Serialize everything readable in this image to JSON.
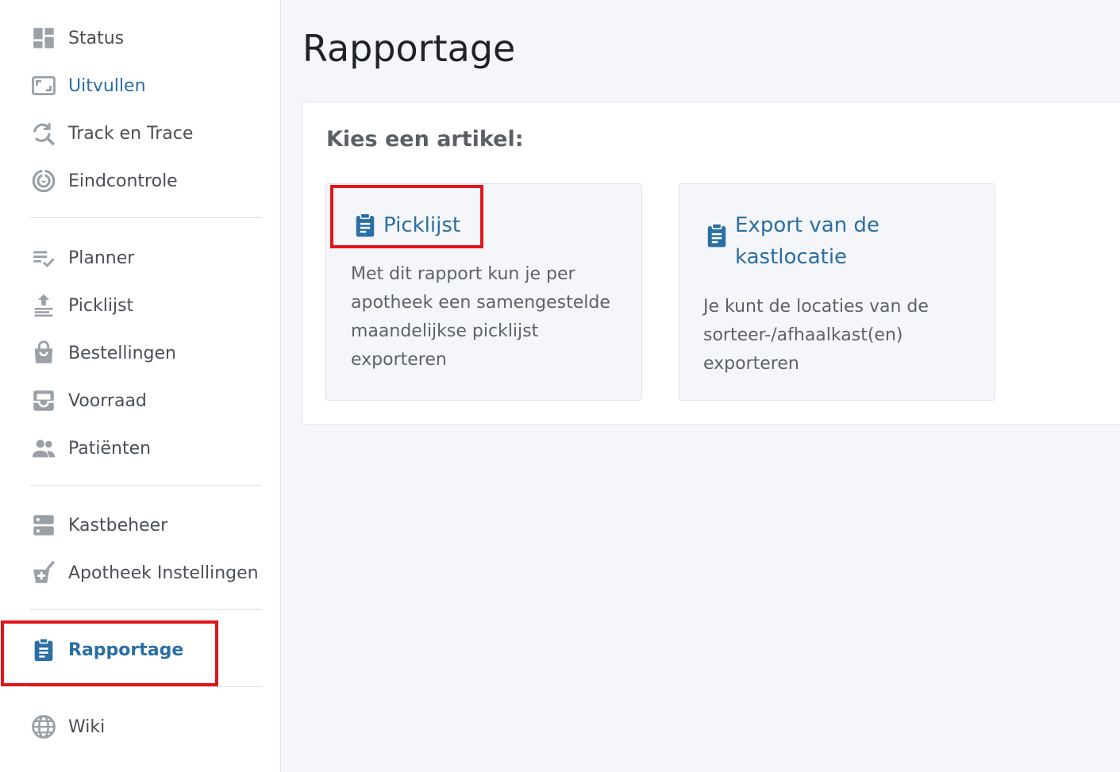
{
  "sidebar": {
    "items": [
      {
        "label": "Status",
        "icon": "dashboard-icon"
      },
      {
        "label": "Uitvullen",
        "icon": "aspect-ratio-icon"
      },
      {
        "label": "Track en Trace",
        "icon": "search-refresh-icon"
      },
      {
        "label": "Eindcontrole",
        "icon": "target-icon"
      },
      {
        "label": "Planner",
        "icon": "checklist-icon"
      },
      {
        "label": "Picklijst",
        "icon": "upload-list-icon"
      },
      {
        "label": "Bestellingen",
        "icon": "shopping-bag-icon"
      },
      {
        "label": "Voorraad",
        "icon": "inbox-tray-icon"
      },
      {
        "label": "Patiënten",
        "icon": "people-icon"
      },
      {
        "label": "Kastbeheer",
        "icon": "server-icon"
      },
      {
        "label": "Apotheek Instellingen",
        "icon": "mortar-pestle-icon"
      },
      {
        "label": "Rapportage",
        "icon": "clipboard-list-icon",
        "active": true
      },
      {
        "label": "Wiki",
        "icon": "globe-icon"
      }
    ]
  },
  "main": {
    "title": "Rapportage",
    "heading": "Kies een artikel:",
    "cards": [
      {
        "title": "Picklijst",
        "description": "Met dit rapport kun je per apotheek een samengestelde maandelijkse picklijst exporteren",
        "icon": "clipboard-list-icon"
      },
      {
        "title": "Export van de kastlocatie",
        "description": "Je kunt de locaties van de sorteer-/afhaalkast(en) exporteren",
        "icon": "clipboard-list-icon"
      }
    ]
  },
  "colors": {
    "accent": "#2b6ea3",
    "highlight": "#e0161b",
    "muted_icon": "#9aa0a6",
    "background": "#f5f6f9"
  }
}
